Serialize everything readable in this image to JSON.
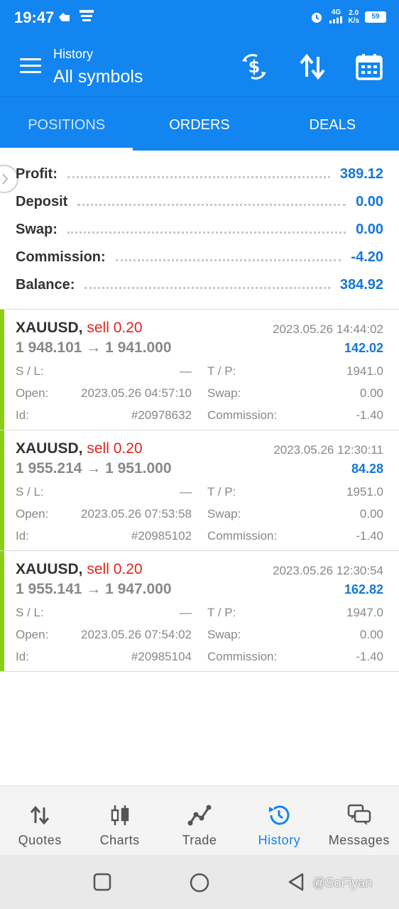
{
  "status_bar": {
    "time": "19:47",
    "network_speed": "2.0",
    "network_unit": "K/s",
    "network_type": "4G",
    "battery": "59"
  },
  "app_bar": {
    "subtitle": "History",
    "title": "All symbols",
    "icons": [
      "menu-icon",
      "currency-exchange-icon",
      "sort-icon",
      "calendar-icon"
    ]
  },
  "tabs": [
    {
      "label": "POSITIONS",
      "active": true
    },
    {
      "label": "ORDERS",
      "active": false
    },
    {
      "label": "DEALS",
      "active": false
    }
  ],
  "summary": {
    "profit": {
      "label": "Profit:",
      "value": "389.12"
    },
    "deposit": {
      "label": "Deposit",
      "value": "0.00"
    },
    "swap": {
      "label": "Swap:",
      "value": "0.00"
    },
    "commission": {
      "label": "Commission:",
      "value": "-4.20"
    },
    "balance": {
      "label": "Balance:",
      "value": "384.92"
    }
  },
  "labels": {
    "sl": "S / L:",
    "tp": "T / P:",
    "open": "Open:",
    "swap": "Swap:",
    "id": "Id:",
    "commission": "Commission:"
  },
  "deals": [
    {
      "symbol": "XAUUSD,",
      "side": "sell 0.20",
      "close_time": "2023.05.26 14:44:02",
      "prices": "1 948.101 → 1 941.000",
      "profit": "142.02",
      "sl": "—",
      "tp": "1941.0",
      "open": "2023.05.26 04:57:10",
      "swap": "0.00",
      "id": "#20978632",
      "commission": "-1.40"
    },
    {
      "symbol": "XAUUSD,",
      "side": "sell 0.20",
      "close_time": "2023.05.26 12:30:11",
      "prices": "1 955.214 → 1 951.000",
      "profit": "84.28",
      "sl": "—",
      "tp": "1951.0",
      "open": "2023.05.26 07:53:58",
      "swap": "0.00",
      "id": "#20985102",
      "commission": "-1.40"
    },
    {
      "symbol": "XAUUSD,",
      "side": "sell 0.20",
      "close_time": "2023.05.26 12:30:54",
      "prices": "1 955.141 → 1 947.000",
      "profit": "162.82",
      "sl": "—",
      "tp": "1947.0",
      "open": "2023.05.26 07:54:02",
      "swap": "0.00",
      "id": "#20985104",
      "commission": "-1.40"
    }
  ],
  "bottom_nav": [
    {
      "label": "Quotes",
      "icon": "quotes-icon",
      "active": false
    },
    {
      "label": "Charts",
      "icon": "charts-icon",
      "active": false
    },
    {
      "label": "Trade",
      "icon": "trade-icon",
      "active": false
    },
    {
      "label": "History",
      "icon": "history-icon",
      "active": true
    },
    {
      "label": "Messages",
      "icon": "messages-icon",
      "active": false
    }
  ],
  "watermark": "@SoFiyan",
  "colors": {
    "primary": "#1385f0",
    "profit": "#1676d8",
    "sell": "#e0241e",
    "deal_bar": "#8cce14"
  }
}
